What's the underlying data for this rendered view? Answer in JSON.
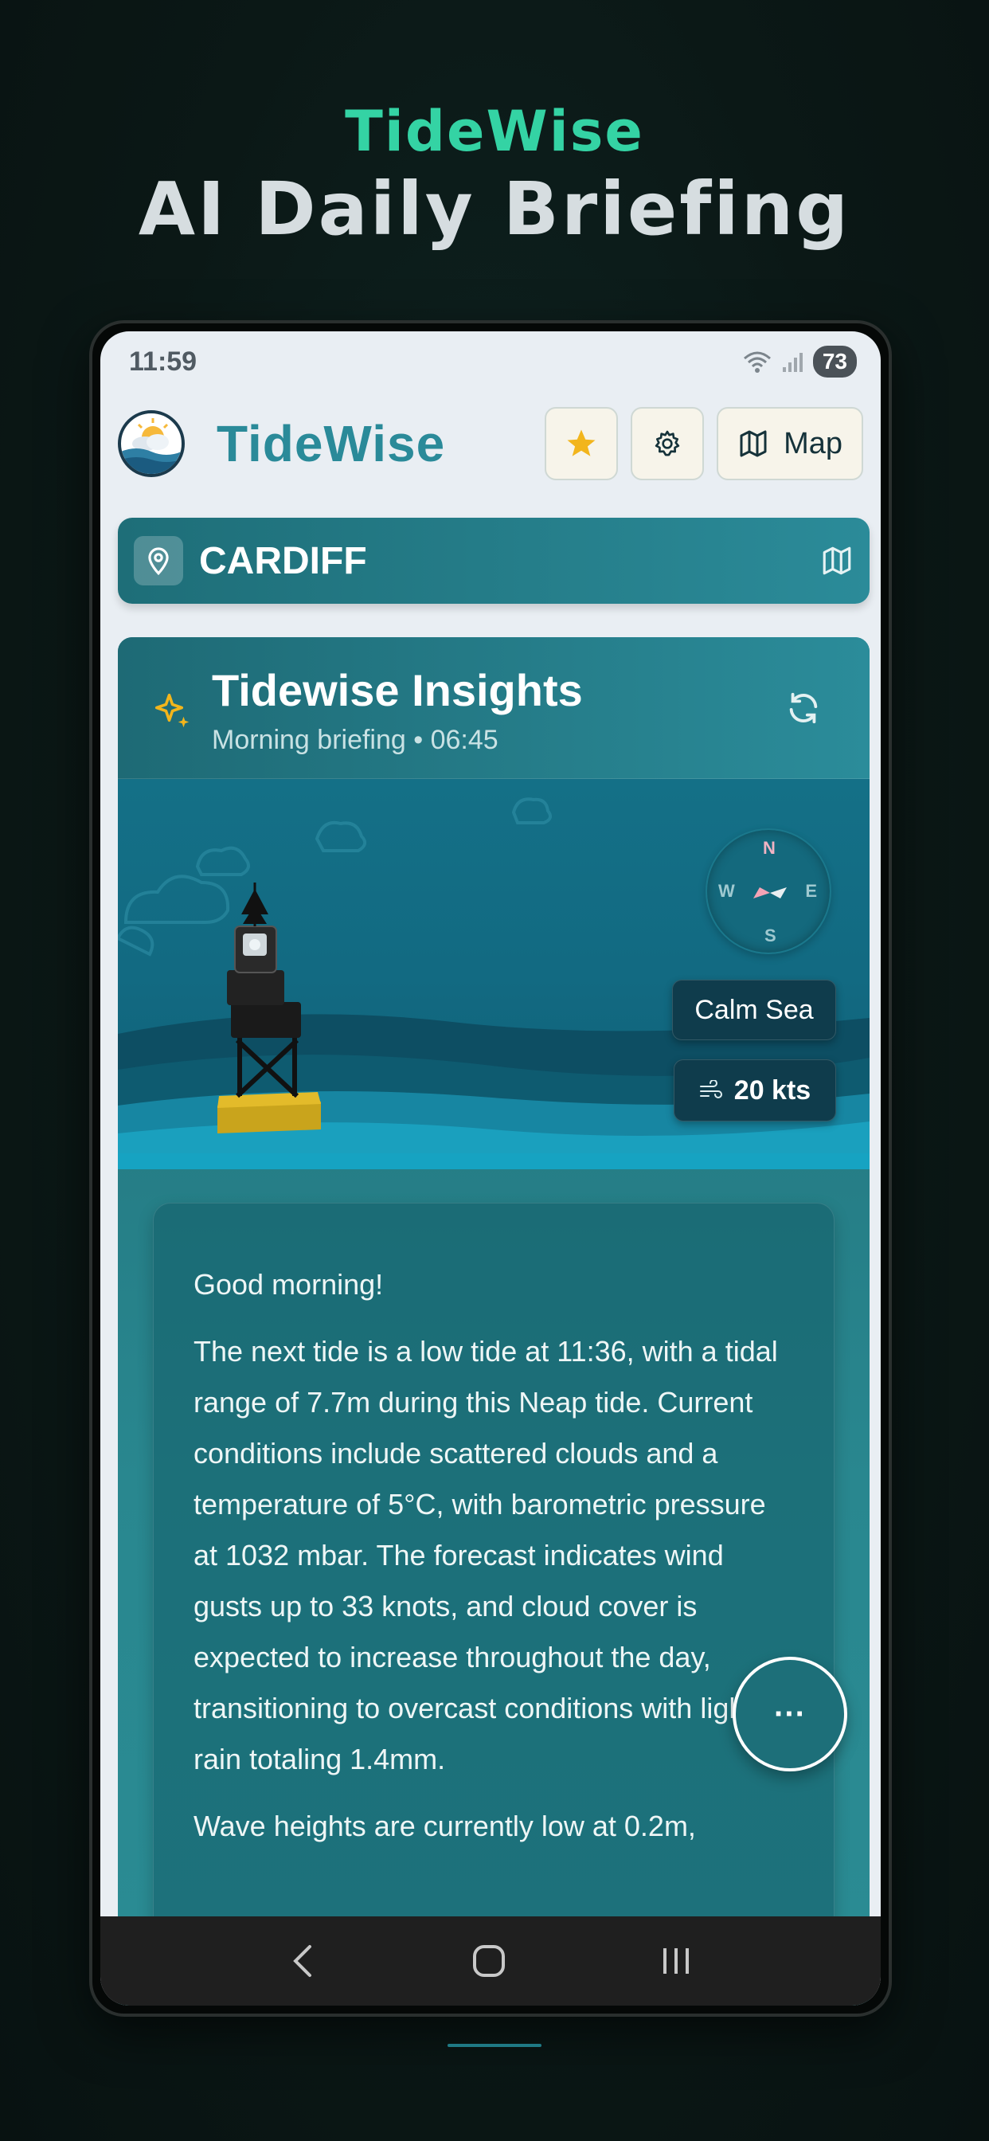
{
  "hero": {
    "brand": "TideWise",
    "title": "AI Daily Briefing"
  },
  "status_bar": {
    "time": "11:59",
    "battery": "73"
  },
  "header": {
    "app_name": "TideWise",
    "buttons": {
      "favorite_icon": "star-icon",
      "settings_icon": "gear-icon",
      "map_label": "Map"
    }
  },
  "location": {
    "name": "CARDIFF"
  },
  "insights": {
    "title": "Tidewise Insights",
    "subtitle": "Morning briefing • 06:45",
    "compass": {
      "n": "N",
      "e": "E",
      "s": "S",
      "w": "W"
    },
    "sea_state": "Calm Sea",
    "wind": "20 kts",
    "greeting": "Good morning!",
    "paragraph_1": "The next tide is a low tide at 11:36, with a tidal range of 7.7m during this Neap tide. Current conditions include scattered clouds and a temperature of 5°C, with barometric pressure at 1032 mbar. The forecast indicates wind gusts up to 33 knots, and cloud cover is expected to increase throughout the day, transitioning to overcast conditions with light rain totaling 1.4mm.",
    "paragraph_2": "Wave heights are currently low at 0.2m,",
    "more_button": "···"
  },
  "colors": {
    "accent": "#34d3a4",
    "teal": "#2a8a99",
    "star": "#f2b51c"
  }
}
